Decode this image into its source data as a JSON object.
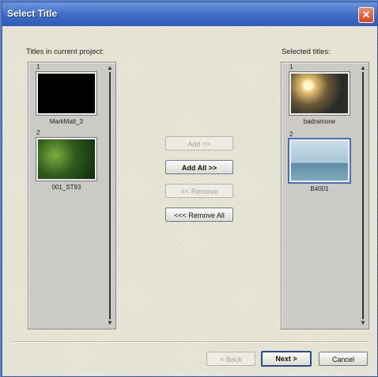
{
  "window": {
    "title": "Select Title",
    "close_glyph": "✕"
  },
  "left_panel": {
    "label": "Titles in current project:",
    "items": [
      {
        "number": "1",
        "caption": "MarkMatt_3",
        "thumb": "black"
      },
      {
        "number": "2",
        "caption": "001_ST93",
        "thumb": "green"
      }
    ]
  },
  "right_panel": {
    "label": "Selected titles:",
    "items": [
      {
        "number": "1",
        "caption": "badramone",
        "thumb": "sunset"
      },
      {
        "number": "2",
        "caption": "B4001",
        "thumb": "sky"
      }
    ]
  },
  "actions": {
    "add": "Add >>",
    "add_all": "Add All >>",
    "remove": "<< Remove",
    "remove_all": "<<< Remove All"
  },
  "footer": {
    "back": "< Back",
    "next": "Next >",
    "cancel": "Cancel"
  },
  "icons": {
    "scroll_up": "▲",
    "scroll_down": "▼"
  }
}
